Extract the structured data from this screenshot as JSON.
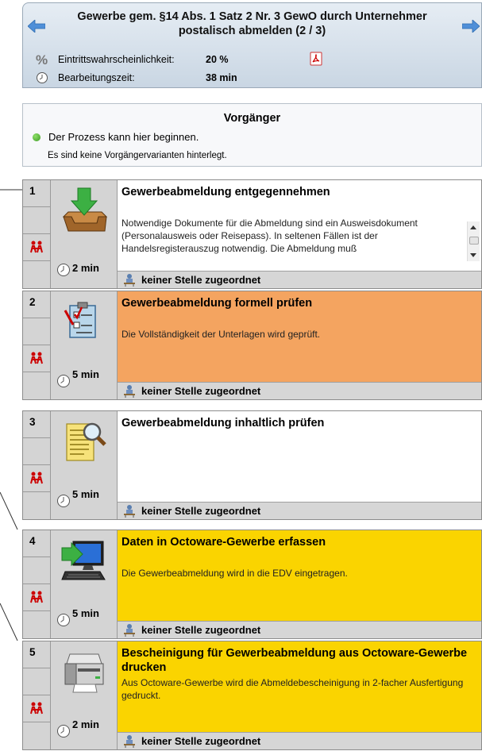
{
  "header": {
    "title": "Gewerbe gem. §14 Abs. 1 Satz 2 Nr. 3 GewO durch Unternehmer postalisch abmelden (2 / 3)",
    "probability_label": "Eintrittswahrscheinlichkeit:",
    "probability_value": "20 %",
    "processing_label": "Bearbeitungszeit:",
    "processing_value": "38 min"
  },
  "predecessor": {
    "title": "Vorgänger",
    "start_text": "Der Prozess kann hier beginnen.",
    "no_variants_text": "Es sind keine Vorgängervarianten hinterlegt."
  },
  "colors": {
    "orange": "#f4a460",
    "yellow": "#fad400",
    "gray": "#d4d4d4"
  },
  "steps": [
    {
      "num": "1",
      "title": "Gewerbeabmeldung entgegennehmen",
      "desc": "Notwendige Dokumente für die Abmeldung sind ein Ausweisdokument (Personalausweis oder Reisepass). In seltenen Fällen ist der Handelsregisterauszug notwendig. Die Abmeldung muß",
      "time": "2 min",
      "responsible": "keiner Stelle zugeordnet",
      "icon": "inbox-download-icon",
      "color": "white"
    },
    {
      "num": "2",
      "title": "Gewerbeabmeldung formell prüfen",
      "desc": "Die Vollständigkeit der Unterlagen wird geprüft.",
      "time": "5 min",
      "responsible": "keiner Stelle zugeordnet",
      "icon": "checklist-icon",
      "color": "orange"
    },
    {
      "num": "3",
      "title": "Gewerbeabmeldung inhaltlich prüfen",
      "desc": "",
      "time": "5 min",
      "responsible": "keiner Stelle zugeordnet",
      "icon": "document-magnifier-icon",
      "color": "white"
    },
    {
      "num": "4",
      "title": "Daten in Octoware-Gewerbe erfassen",
      "desc": "Die Gewerbeabmeldung wird in die EDV eingetragen.",
      "time": "5 min",
      "responsible": "keiner Stelle zugeordnet",
      "icon": "computer-input-icon",
      "color": "yellow"
    },
    {
      "num": "5",
      "title": "Bescheinigung für Gewerbeabmeldung aus Octoware-Gewerbe drucken",
      "desc": "Aus Octoware-Gewerbe wird die Abmeldebescheinigung in 2-facher Ausfertigung gedruckt.",
      "time": "2 min",
      "responsible": "keiner Stelle zugeordnet",
      "icon": "printer-icon",
      "color": "yellow"
    }
  ]
}
